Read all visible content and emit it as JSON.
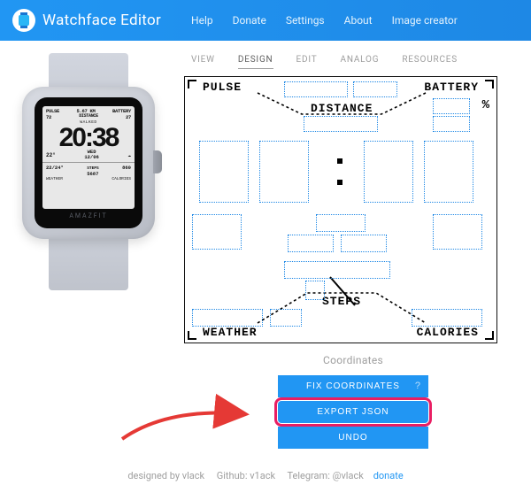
{
  "header": {
    "app_title": "Watchface Editor",
    "nav": [
      "Help",
      "Donate",
      "Settings",
      "About",
      "Image creator"
    ]
  },
  "tabs": {
    "items": [
      "VIEW",
      "DESIGN",
      "EDIT",
      "ANALOG",
      "RESOURCES"
    ],
    "active": "DESIGN"
  },
  "watch": {
    "brand": "AMAZFIT",
    "pulse_label": "PULSE",
    "pulse_val": "72",
    "distance_val": "5.67",
    "distance_unit": "KM",
    "distance_label": "DISTANCE",
    "battery_label": "BATTERY",
    "walked_label": "WALKED",
    "battery_val": "27",
    "time": "20:38",
    "temp": "22°",
    "day": "WED",
    "date": "12/06",
    "alarm": "22/24°",
    "steps_label": "STEPS",
    "steps_val": "5687",
    "calories_val": "860",
    "weather_label": "WEATHER",
    "calories_label": "CALORIES"
  },
  "canvas": {
    "labels": {
      "pulse": "PULSE",
      "battery": "BATTERY",
      "distance": "DISTANCE",
      "steps": "STEPS",
      "weather": "WEATHER",
      "calories": "CALORIES",
      "percent": "%"
    }
  },
  "buttons": {
    "coordinates_label": "Coordinates",
    "fix": "FIX COORDINATES",
    "export": "EXPORT JSON",
    "undo": "UNDO"
  },
  "footer": {
    "designed": "designed by vlack",
    "github": "Github: v1ack",
    "telegram": "Telegram: @vlack",
    "donate": "donate"
  }
}
